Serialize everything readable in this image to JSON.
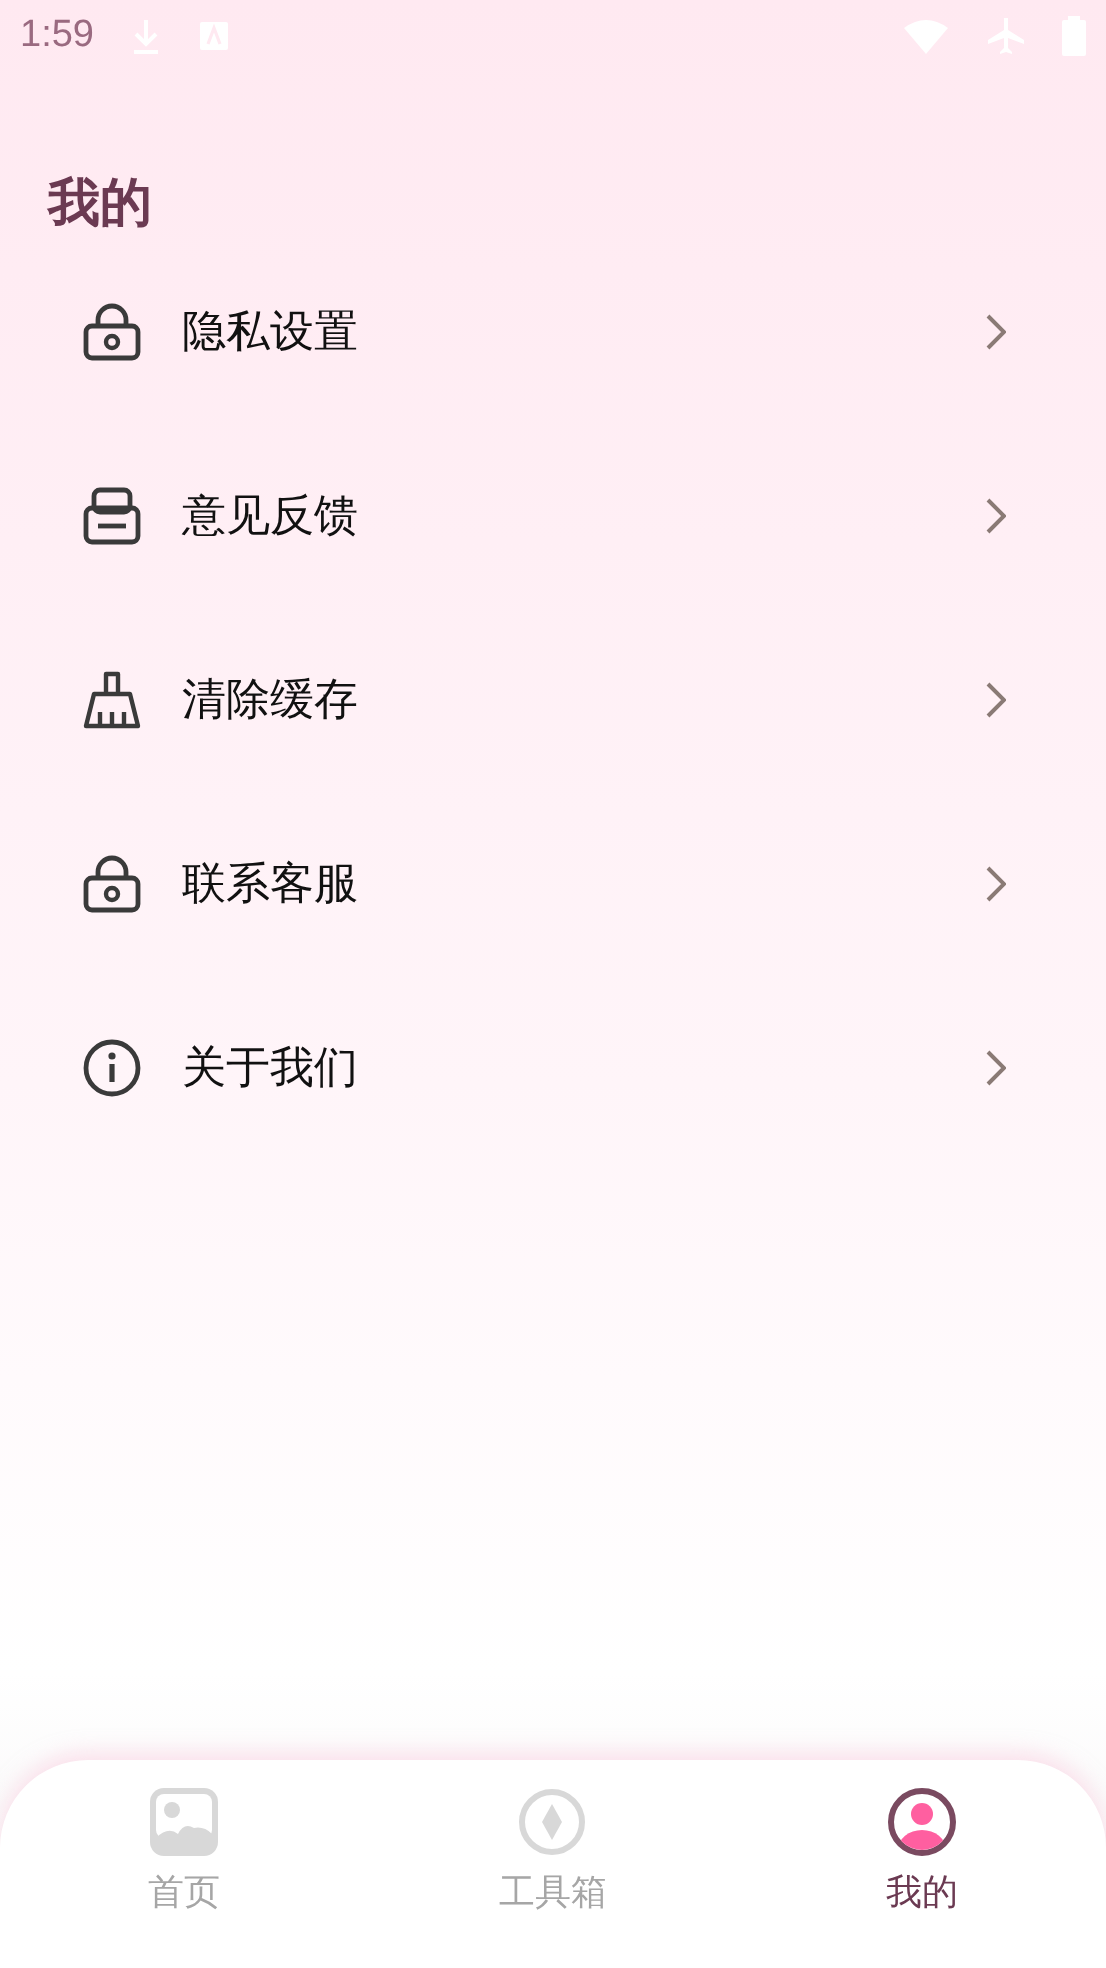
{
  "status_bar": {
    "time": "1:59"
  },
  "title": "我的",
  "menu_items": [
    {
      "kind": "lock",
      "label": "隐私设置"
    },
    {
      "kind": "tray",
      "label": "意见反馈"
    },
    {
      "kind": "broom",
      "label": "清除缓存"
    },
    {
      "kind": "lock",
      "label": "联系客服"
    },
    {
      "kind": "info",
      "label": "关于我们"
    }
  ],
  "tabs": [
    {
      "kind": "image",
      "label": "首页",
      "selected": false
    },
    {
      "kind": "compass",
      "label": "工具箱",
      "selected": false
    },
    {
      "kind": "person",
      "label": "我的",
      "selected": true
    }
  ]
}
